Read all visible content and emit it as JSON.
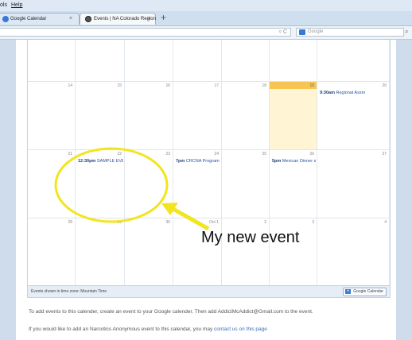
{
  "menu": {
    "tools": "ols",
    "help": "Help"
  },
  "tabs": [
    {
      "label": "Google Calendar",
      "close": "×"
    },
    {
      "label": "Events | NA Colorado Region",
      "close": "×"
    }
  ],
  "new_tab": "+",
  "url_icons": "▿ C",
  "search": {
    "placeholder": "Google"
  },
  "calendar": {
    "weeks": [
      {
        "days": [
          {
            "num": ""
          },
          {
            "num": ""
          },
          {
            "num": ""
          },
          {
            "num": ""
          },
          {
            "num": ""
          },
          {
            "num": ""
          },
          {
            "num": ""
          }
        ]
      },
      {
        "days": [
          {
            "num": "14"
          },
          {
            "num": "15"
          },
          {
            "num": "16"
          },
          {
            "num": "17"
          },
          {
            "num": "18"
          },
          {
            "num": "19",
            "today": true
          },
          {
            "num": "20",
            "time": "9:30am",
            "title": "Regional Assm"
          }
        ]
      },
      {
        "days": [
          {
            "num": "21"
          },
          {
            "num": "22",
            "time": "12:30pm",
            "title": "SAMPLE EVE"
          },
          {
            "num": "23"
          },
          {
            "num": "24",
            "time": "7pm",
            "title": "CRCNA Program"
          },
          {
            "num": "25"
          },
          {
            "num": "26",
            "time": "5pm",
            "title": "Mexican Dinner a"
          },
          {
            "num": "27"
          }
        ]
      },
      {
        "days": [
          {
            "num": "28"
          },
          {
            "num": "29"
          },
          {
            "num": "30"
          },
          {
            "num": "Oct 1"
          },
          {
            "num": "2"
          },
          {
            "num": "3"
          },
          {
            "num": "4"
          }
        ]
      }
    ],
    "footer_tz": "Events shown in time zone: Mountain Time",
    "gcal_button": "Google Calendar"
  },
  "paragraph1": "To add events to this calender, create an event to your Google calender. Then add AddictMcAddict@Gmail.com to the event.",
  "paragraph2_prefix": "If you would like to add an Narcotics Anonymous event to this calendar, you may ",
  "paragraph2_link": "contact us on this page",
  "annotation": "My new event",
  "colors": {
    "today": "#fff4d3",
    "annotation": "#f2e51e",
    "link": "#3a6fbd"
  }
}
